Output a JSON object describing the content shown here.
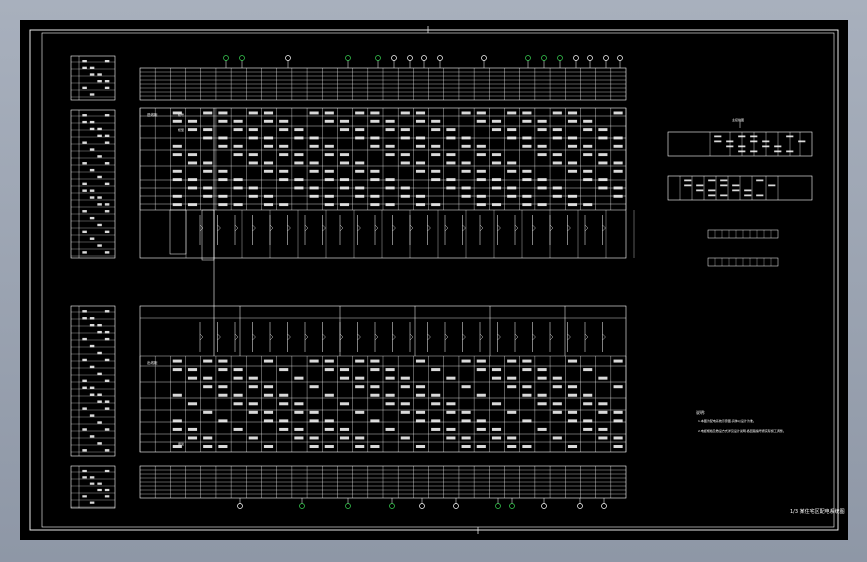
{
  "drawing": {
    "title_block_text": "1/3 某住宅区配电系统图",
    "notes_heading": "说明:",
    "notes_lines": [
      "1.本图为配电系统示意图,具体以设计为准。",
      "2.电缆规格及敷设方式详见设计说明,各回路编号按实际施工调整。"
    ],
    "small_table_title": "主接线图",
    "left_header_top": "进线柜",
    "left_header_bottom": "出线柜",
    "row_label_1": "柜号",
    "row_label_2": "柜型",
    "row_label_3": "用途",
    "colors": {
      "background": "#000000",
      "line": "#ffffff",
      "accent": "#39d353",
      "desktop": "#9aa2b0"
    }
  }
}
